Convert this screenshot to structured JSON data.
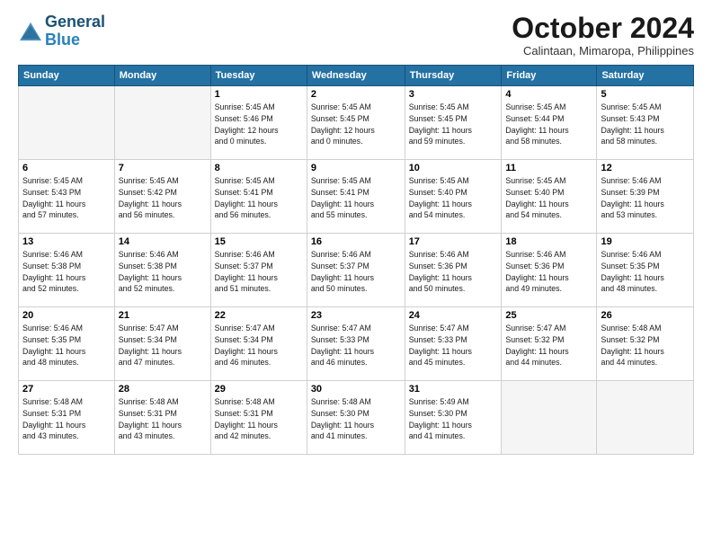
{
  "header": {
    "logo_line1": "General",
    "logo_line2": "Blue",
    "month": "October 2024",
    "location": "Calintaan, Mimaropa, Philippines"
  },
  "weekdays": [
    "Sunday",
    "Monday",
    "Tuesday",
    "Wednesday",
    "Thursday",
    "Friday",
    "Saturday"
  ],
  "weeks": [
    [
      {
        "day": "",
        "info": ""
      },
      {
        "day": "",
        "info": ""
      },
      {
        "day": "1",
        "info": "Sunrise: 5:45 AM\nSunset: 5:46 PM\nDaylight: 12 hours\nand 0 minutes."
      },
      {
        "day": "2",
        "info": "Sunrise: 5:45 AM\nSunset: 5:45 PM\nDaylight: 12 hours\nand 0 minutes."
      },
      {
        "day": "3",
        "info": "Sunrise: 5:45 AM\nSunset: 5:45 PM\nDaylight: 11 hours\nand 59 minutes."
      },
      {
        "day": "4",
        "info": "Sunrise: 5:45 AM\nSunset: 5:44 PM\nDaylight: 11 hours\nand 58 minutes."
      },
      {
        "day": "5",
        "info": "Sunrise: 5:45 AM\nSunset: 5:43 PM\nDaylight: 11 hours\nand 58 minutes."
      }
    ],
    [
      {
        "day": "6",
        "info": "Sunrise: 5:45 AM\nSunset: 5:43 PM\nDaylight: 11 hours\nand 57 minutes."
      },
      {
        "day": "7",
        "info": "Sunrise: 5:45 AM\nSunset: 5:42 PM\nDaylight: 11 hours\nand 56 minutes."
      },
      {
        "day": "8",
        "info": "Sunrise: 5:45 AM\nSunset: 5:41 PM\nDaylight: 11 hours\nand 56 minutes."
      },
      {
        "day": "9",
        "info": "Sunrise: 5:45 AM\nSunset: 5:41 PM\nDaylight: 11 hours\nand 55 minutes."
      },
      {
        "day": "10",
        "info": "Sunrise: 5:45 AM\nSunset: 5:40 PM\nDaylight: 11 hours\nand 54 minutes."
      },
      {
        "day": "11",
        "info": "Sunrise: 5:45 AM\nSunset: 5:40 PM\nDaylight: 11 hours\nand 54 minutes."
      },
      {
        "day": "12",
        "info": "Sunrise: 5:46 AM\nSunset: 5:39 PM\nDaylight: 11 hours\nand 53 minutes."
      }
    ],
    [
      {
        "day": "13",
        "info": "Sunrise: 5:46 AM\nSunset: 5:38 PM\nDaylight: 11 hours\nand 52 minutes."
      },
      {
        "day": "14",
        "info": "Sunrise: 5:46 AM\nSunset: 5:38 PM\nDaylight: 11 hours\nand 52 minutes."
      },
      {
        "day": "15",
        "info": "Sunrise: 5:46 AM\nSunset: 5:37 PM\nDaylight: 11 hours\nand 51 minutes."
      },
      {
        "day": "16",
        "info": "Sunrise: 5:46 AM\nSunset: 5:37 PM\nDaylight: 11 hours\nand 50 minutes."
      },
      {
        "day": "17",
        "info": "Sunrise: 5:46 AM\nSunset: 5:36 PM\nDaylight: 11 hours\nand 50 minutes."
      },
      {
        "day": "18",
        "info": "Sunrise: 5:46 AM\nSunset: 5:36 PM\nDaylight: 11 hours\nand 49 minutes."
      },
      {
        "day": "19",
        "info": "Sunrise: 5:46 AM\nSunset: 5:35 PM\nDaylight: 11 hours\nand 48 minutes."
      }
    ],
    [
      {
        "day": "20",
        "info": "Sunrise: 5:46 AM\nSunset: 5:35 PM\nDaylight: 11 hours\nand 48 minutes."
      },
      {
        "day": "21",
        "info": "Sunrise: 5:47 AM\nSunset: 5:34 PM\nDaylight: 11 hours\nand 47 minutes."
      },
      {
        "day": "22",
        "info": "Sunrise: 5:47 AM\nSunset: 5:34 PM\nDaylight: 11 hours\nand 46 minutes."
      },
      {
        "day": "23",
        "info": "Sunrise: 5:47 AM\nSunset: 5:33 PM\nDaylight: 11 hours\nand 46 minutes."
      },
      {
        "day": "24",
        "info": "Sunrise: 5:47 AM\nSunset: 5:33 PM\nDaylight: 11 hours\nand 45 minutes."
      },
      {
        "day": "25",
        "info": "Sunrise: 5:47 AM\nSunset: 5:32 PM\nDaylight: 11 hours\nand 44 minutes."
      },
      {
        "day": "26",
        "info": "Sunrise: 5:48 AM\nSunset: 5:32 PM\nDaylight: 11 hours\nand 44 minutes."
      }
    ],
    [
      {
        "day": "27",
        "info": "Sunrise: 5:48 AM\nSunset: 5:31 PM\nDaylight: 11 hours\nand 43 minutes."
      },
      {
        "day": "28",
        "info": "Sunrise: 5:48 AM\nSunset: 5:31 PM\nDaylight: 11 hours\nand 43 minutes."
      },
      {
        "day": "29",
        "info": "Sunrise: 5:48 AM\nSunset: 5:31 PM\nDaylight: 11 hours\nand 42 minutes."
      },
      {
        "day": "30",
        "info": "Sunrise: 5:48 AM\nSunset: 5:30 PM\nDaylight: 11 hours\nand 41 minutes."
      },
      {
        "day": "31",
        "info": "Sunrise: 5:49 AM\nSunset: 5:30 PM\nDaylight: 11 hours\nand 41 minutes."
      },
      {
        "day": "",
        "info": ""
      },
      {
        "day": "",
        "info": ""
      }
    ]
  ]
}
